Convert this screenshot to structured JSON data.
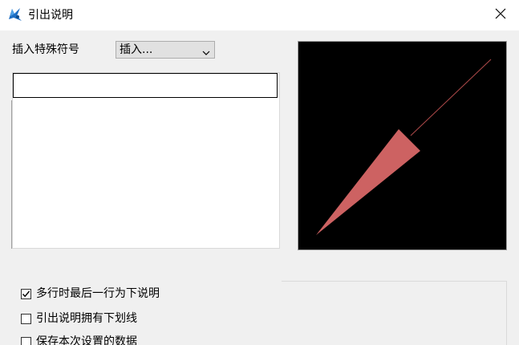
{
  "window": {
    "title": "引出说明",
    "icon": "app-logo-icon",
    "close_icon": "close-icon"
  },
  "insert_special": {
    "label": "插入特殊符号",
    "dropdown_value": "插入..."
  },
  "text_input": {
    "value": ""
  },
  "preview": {
    "background": "#000000",
    "arrow_color": "#cd6262",
    "line_color": "#b04a4a"
  },
  "options": [
    {
      "label": "多行时最后一行为下说明",
      "checked": true
    },
    {
      "label": "引出说明拥有下划线",
      "checked": false
    },
    {
      "label": "保存本次设置的数据",
      "checked": false
    }
  ]
}
